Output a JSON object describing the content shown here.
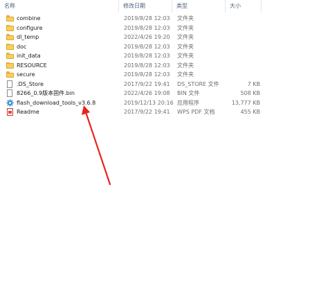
{
  "columns": {
    "name": "名称",
    "date": "修改日期",
    "type": "类型",
    "size": "大小"
  },
  "files": [
    {
      "name": "combine",
      "date": "2019/8/28 12:03",
      "type": "文件夹",
      "size": "",
      "icon": "folder-icon"
    },
    {
      "name": "configure",
      "date": "2019/8/28 12:03",
      "type": "文件夹",
      "size": "",
      "icon": "folder-icon"
    },
    {
      "name": "dl_temp",
      "date": "2022/4/26 19:20",
      "type": "文件夹",
      "size": "",
      "icon": "folder-icon"
    },
    {
      "name": "doc",
      "date": "2019/8/28 12:03",
      "type": "文件夹",
      "size": "",
      "icon": "folder-icon"
    },
    {
      "name": "init_data",
      "date": "2019/8/28 12:03",
      "type": "文件夹",
      "size": "",
      "icon": "folder-icon"
    },
    {
      "name": "RESOURCE",
      "date": "2019/8/28 12:03",
      "type": "文件夹",
      "size": "",
      "icon": "folder-icon"
    },
    {
      "name": "secure",
      "date": "2019/8/28 12:03",
      "type": "文件夹",
      "size": "",
      "icon": "folder-icon"
    },
    {
      "name": ".DS_Store",
      "date": "2017/9/22 19:41",
      "type": "DS_STORE 文件",
      "size": "7 KB",
      "icon": "file-icon"
    },
    {
      "name": "8266_0.9版本固件.bin",
      "date": "2022/4/26 19:08",
      "type": "BIN 文件",
      "size": "508 KB",
      "icon": "file-icon"
    },
    {
      "name": "flash_download_tools_v3.6.8",
      "date": "2019/12/13 20:16",
      "type": "应用程序",
      "size": "13,777 KB",
      "icon": "gear-icon"
    },
    {
      "name": "Readme",
      "date": "2017/9/22 19:41",
      "type": "WPS PDF 文档",
      "size": "455 KB",
      "icon": "pdf-icon"
    }
  ],
  "colors": {
    "arrow": "#e8231c",
    "header_text": "#4c607a",
    "meta_text": "#6d6d6d"
  }
}
